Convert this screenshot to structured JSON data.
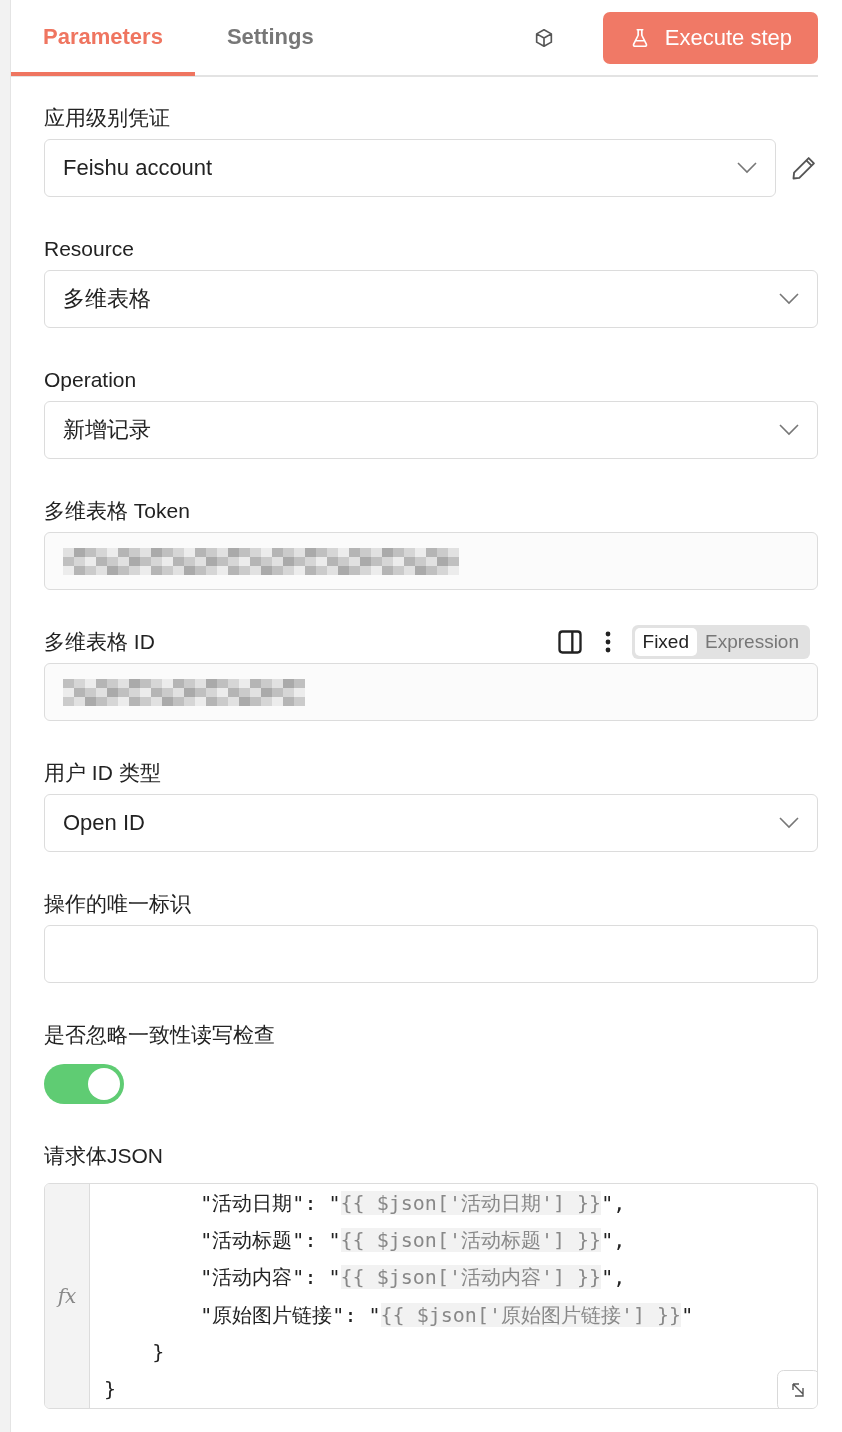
{
  "tabs": [
    {
      "label": "Parameters",
      "selected": true
    },
    {
      "label": "Settings",
      "selected": false
    }
  ],
  "execute_button": {
    "label": "Execute step"
  },
  "fields": [
    {
      "kind": "select",
      "label": "应用级别凭证",
      "value": "Feishu account",
      "editable": true
    },
    {
      "kind": "select",
      "label": "Resource",
      "value": "多维表格"
    },
    {
      "kind": "select",
      "label": "Operation",
      "value": "新增记录"
    },
    {
      "kind": "redacted",
      "label": "多维表格 Token"
    },
    {
      "kind": "redacted",
      "label": "多维表格 ID",
      "mode_switch": [
        {
          "label": "Fixed",
          "selected": true
        },
        {
          "label": "Expression",
          "selected": false
        }
      ]
    },
    {
      "kind": "select",
      "label": "用户 ID 类型",
      "value": "Open ID"
    },
    {
      "kind": "text",
      "label": "操作的唯一标识"
    },
    {
      "kind": "toggle",
      "label": "是否忽略一致性读写检查",
      "on": true
    },
    {
      "kind": "code",
      "label": "请求体JSON",
      "gutter": "fx",
      "lines": [
        {
          "text": "        \"活动日期\": \"",
          "expr": "{{ $json['活动日期'] }}",
          "after": "\","
        },
        {
          "text": "        \"活动标题\": \"",
          "expr": "{{ $json['活动标题'] }}",
          "after": "\","
        },
        {
          "text": "        \"活动内容\": \"",
          "expr": "{{ $json['活动内容'] }}",
          "after": "\","
        },
        {
          "text": "        \"原始图片链接\": \"",
          "expr": "{{ $json['原始图片链接'] }}",
          "after": "\""
        },
        {
          "text": "    }"
        },
        {
          "text": "}"
        }
      ]
    }
  ]
}
